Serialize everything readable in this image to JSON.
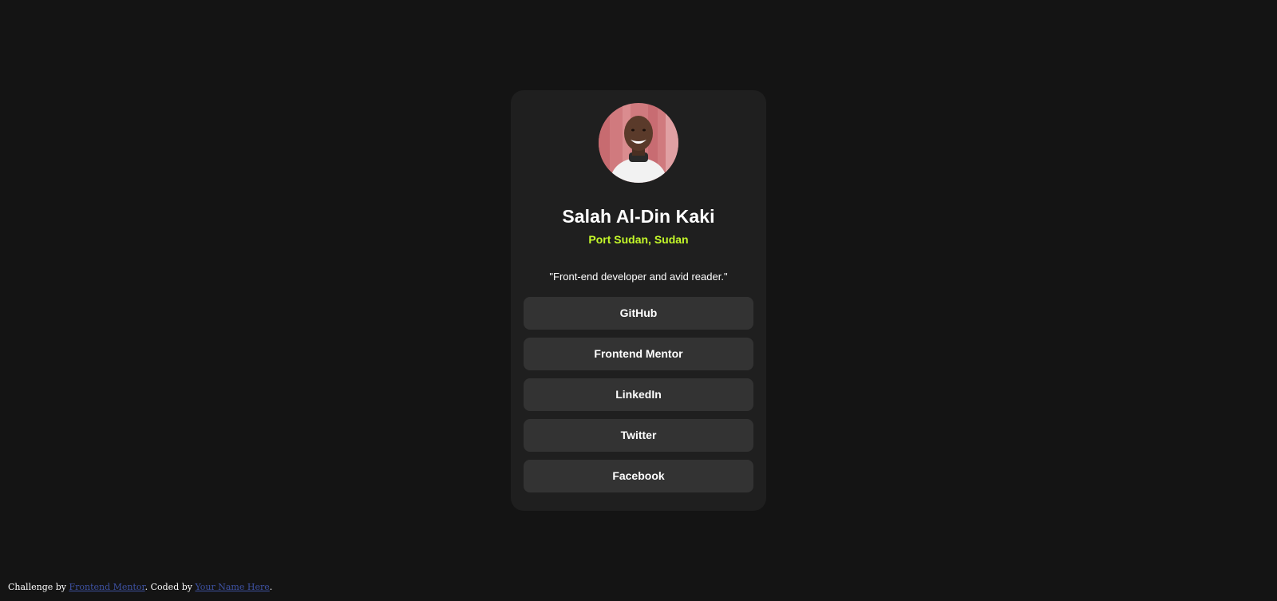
{
  "profile": {
    "name": "Salah Al-Din Kaki",
    "location": "Port Sudan, Sudan",
    "bio": "\"Front-end developer and avid reader.\"",
    "avatar_alt": "avatar"
  },
  "links": [
    {
      "label": "GitHub"
    },
    {
      "label": "Frontend Mentor"
    },
    {
      "label": "LinkedIn"
    },
    {
      "label": "Twitter"
    },
    {
      "label": "Facebook"
    }
  ],
  "footer": {
    "prefix": "Challenge by ",
    "challenge_link": "Frontend Mentor",
    "middle": ". Coded by ",
    "author_link": "Your Name Here",
    "suffix": "."
  },
  "colors": {
    "background": "#141414",
    "card": "#1f1f1f",
    "button": "#333333",
    "accent": "#c4f82a",
    "text": "#ffffff",
    "footer_link": "#3e52a3"
  }
}
